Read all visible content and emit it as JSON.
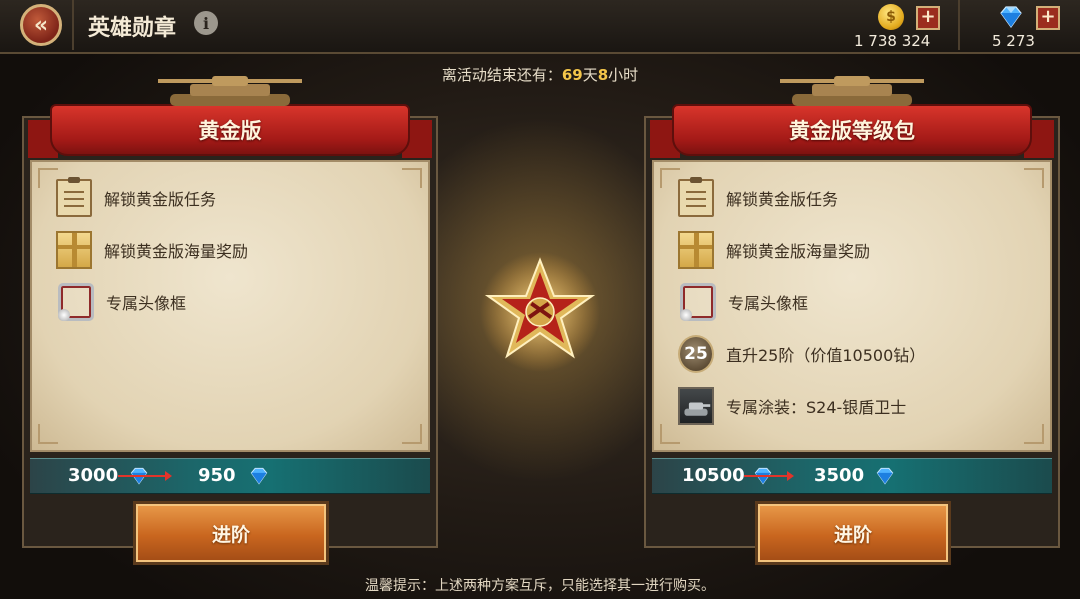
{
  "header": {
    "title": "英雄勋章",
    "info_icon": "i",
    "gold_amount": "1 738 324",
    "diamond_amount": "5 273",
    "plus_label": "+"
  },
  "countdown": {
    "prefix": "离活动结束还有：",
    "days": "69",
    "days_unit": "天",
    "hours": "8",
    "hours_unit": "小时"
  },
  "left_panel": {
    "title": "黄金版",
    "features": [
      {
        "icon": "task-clipboard-icon",
        "text": "解锁黄金版任务"
      },
      {
        "icon": "gift-box-icon",
        "text": "解锁黄金版海量奖励"
      },
      {
        "icon": "avatar-frame-icon",
        "text": "专属头像框"
      }
    ],
    "old_price": "3000",
    "new_price": "950",
    "button_label": "进阶"
  },
  "right_panel": {
    "title": "黄金版等级包",
    "features": [
      {
        "icon": "task-clipboard-icon",
        "text": "解锁黄金版任务"
      },
      {
        "icon": "gift-box-icon",
        "text": "解锁黄金版海量奖励"
      },
      {
        "icon": "avatar-frame-icon",
        "text": "专属头像框"
      },
      {
        "icon": "level-badge-icon",
        "badge": "25",
        "text": "直升25阶（价值10500钻）"
      },
      {
        "icon": "tank-skin-icon",
        "text": "专属涂装：S24-银盾卫士"
      }
    ],
    "old_price": "10500",
    "new_price": "3500",
    "button_label": "进阶"
  },
  "tip": "温馨提示：上述两种方案互斥，只能选择其一进行购买。",
  "colors": {
    "ribbon_red": "#b81f1a",
    "price_teal": "#167072",
    "button_orange": "#c9661f",
    "highlight_yellow": "#f4c64a",
    "arrow_red": "#e2342a"
  }
}
